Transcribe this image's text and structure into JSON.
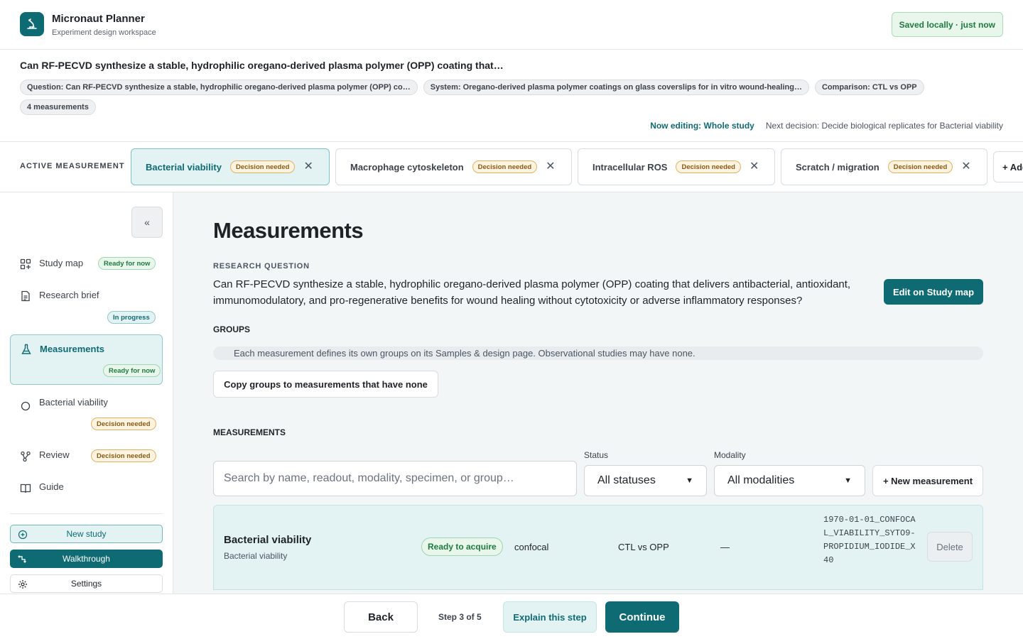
{
  "app": {
    "title": "Micronaut Planner",
    "subtitle": "Experiment design workspace",
    "saved_status": "Saved locally · just now"
  },
  "study": {
    "title": "Can RF-PECVD synthesize a stable, hydrophilic oregano-derived plasma polymer (OPP) coating that…",
    "chips": [
      "Question: Can RF-PECVD synthesize a stable, hydrophilic oregano-derived plasma polymer (OPP) co…",
      "System: Oregano-derived plasma polymer coatings on glass coverslips for in vitro wound-healing…",
      "Comparison: CTL vs OPP",
      "4 measurements"
    ],
    "now_editing": "Now editing: Whole study",
    "next_decision": "Next decision: Decide biological replicates for Bacterial viability"
  },
  "measurement_tabs": {
    "label": "ACTIVE MEASUREMENT",
    "tabs": [
      {
        "label": "Bacterial viability",
        "badge": "Decision needed"
      },
      {
        "label": "Macrophage cytoskeleton",
        "badge": "Decision needed"
      },
      {
        "label": "Intracellular ROS",
        "badge": "Decision needed"
      },
      {
        "label": "Scratch / migration",
        "badge": "Decision needed"
      }
    ],
    "add_label": "+ Add"
  },
  "sidebar": {
    "collapse_label": "«",
    "items": [
      {
        "label": "Study map",
        "badge": "Ready for now"
      },
      {
        "label": "Research brief",
        "badge": "In progress"
      },
      {
        "label": "Measurements",
        "badge": "Ready for now"
      },
      {
        "label": "Bacterial viability",
        "badge": "Decision needed"
      },
      {
        "label": "Review",
        "badge": "Decision needed"
      },
      {
        "label": "Guide"
      }
    ],
    "new_study": "New study",
    "walkthrough": "Walkthrough",
    "settings": "Settings"
  },
  "main": {
    "title": "Measurements",
    "rq_label": "RESEARCH QUESTION",
    "rq_text": "Can RF-PECVD synthesize a stable, hydrophilic oregano-derived plasma polymer (OPP) coating that delivers antibacterial, antioxidant, immunomodulatory, and pro-regenerative benefits for wound healing without cytotoxicity or adverse inflammatory responses?",
    "edit_button": "Edit on Study map",
    "groups_label": "GROUPS",
    "groups_note": "Each measurement defines its own groups on its Samples & design page. Observational studies may have none.",
    "copy_groups_button": "Copy groups to measurements that have none",
    "measurements_label": "MEASUREMENTS",
    "search_placeholder": "Search by name, readout, modality, specimen, or group…",
    "status_label": "Status",
    "status_value": "All statuses",
    "modality_label": "Modality",
    "modality_value": "All modalities",
    "new_measurement_button": "+ New measurement",
    "rows": [
      {
        "name": "Bacterial viability",
        "sub": "Bacterial viability",
        "status": "Ready to acquire",
        "modality": "confocal",
        "comparison": "CTL vs OPP",
        "extra": "—",
        "id": "1970-01-01_CONFOCAL_VIABILITY_SYTO9-PROPIDIUM_IODIDE_X40",
        "delete_label": "Delete"
      }
    ]
  },
  "footer": {
    "back": "Back",
    "step": "Step 3 of 5",
    "explain": "Explain this step",
    "continue": "Continue"
  },
  "colors": {
    "accent": "#0f6b73",
    "accent_light": "#e3f3f4",
    "warn": "#fdf3e1",
    "success": "#e8f6ec"
  }
}
